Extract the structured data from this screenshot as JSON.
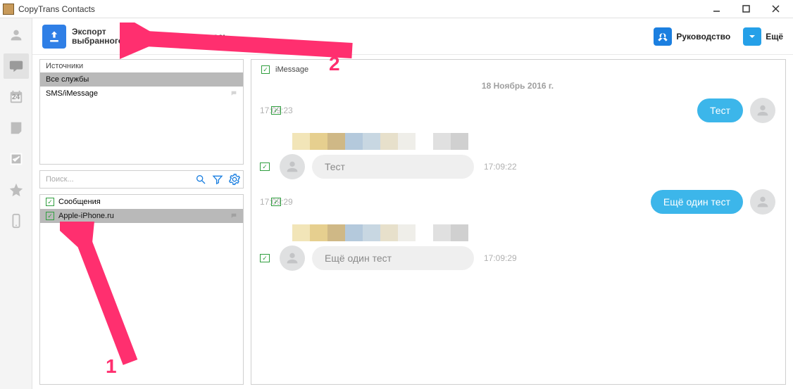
{
  "title": "CopyTrans Contacts",
  "toolbar": {
    "export_line1": "Экспорт",
    "export_line2": "выбранного",
    "hidden_fragment": "лось",
    "guide": "Руководство",
    "more": "Ещё"
  },
  "rail": {
    "calendar_day": "24"
  },
  "sources": {
    "header": "Источники",
    "items": [
      "Все службы",
      "SMS/iMessage"
    ]
  },
  "search": {
    "placeholder": "Поиск..."
  },
  "threads": {
    "header": "Сообщения",
    "items": [
      "Apple-iPhone.ru"
    ]
  },
  "conversation": {
    "service": "iMessage",
    "date": "18 Ноябрь 2016 г.",
    "messages": [
      {
        "dir": "out",
        "text": "Тест",
        "time": "17:09:23"
      },
      {
        "dir": "in",
        "text": "Тест",
        "time": "17:09:22",
        "attachment": true
      },
      {
        "dir": "out",
        "text": "Ещё один тест",
        "time": "17:09:29"
      },
      {
        "dir": "in",
        "text": "Ещё один тест",
        "time": "17:09:29",
        "attachment": true
      }
    ]
  },
  "annotations": {
    "num1": "1",
    "num2": "2"
  }
}
